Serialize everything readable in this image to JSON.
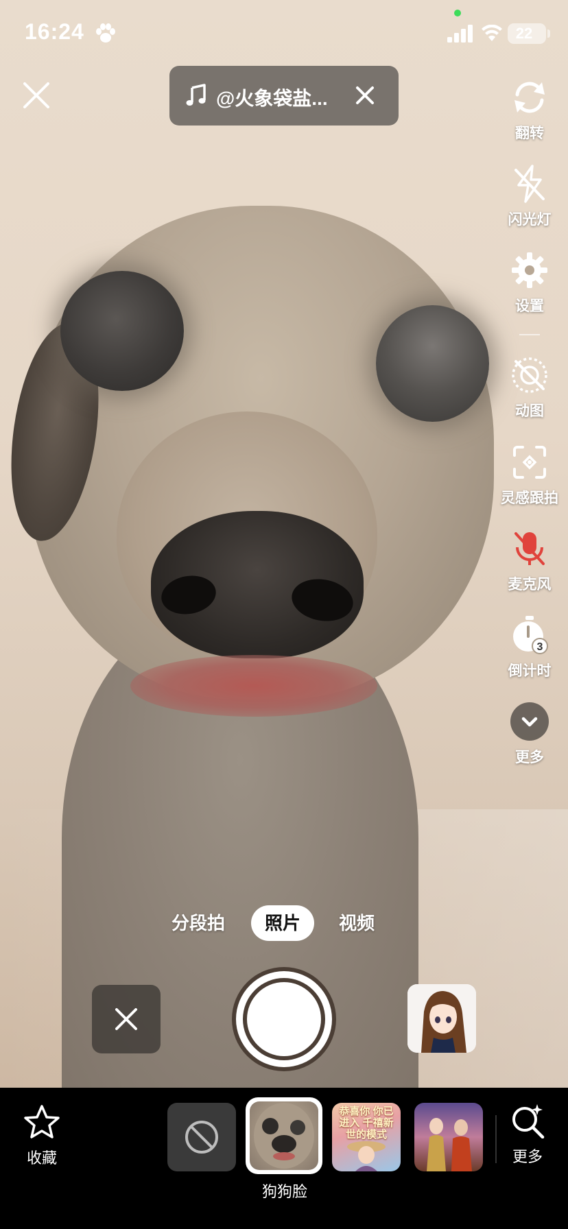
{
  "status_bar": {
    "time": "16:24",
    "battery": "22"
  },
  "music": {
    "label": "@火象袋盐..."
  },
  "tools": {
    "flip": "翻转",
    "flash": "闪光灯",
    "settings": "设置",
    "animated": "动图",
    "inspiration_track": "灵感跟拍",
    "microphone": "麦克风",
    "countdown": "倒计时",
    "countdown_badge": "3",
    "more": "更多"
  },
  "modes": {
    "segment": "分段拍",
    "photo": "照片",
    "video": "视频",
    "active": "照片"
  },
  "bottom_bar": {
    "favorites": "收藏",
    "more": "更多",
    "selected_effect_label": "狗狗脸",
    "effect_3_text": "恭喜你 你已进入 千禧新世的模式"
  },
  "colors": {
    "accent_mic_muted": "#e0433c",
    "shutter_ring": "#ffffff"
  }
}
